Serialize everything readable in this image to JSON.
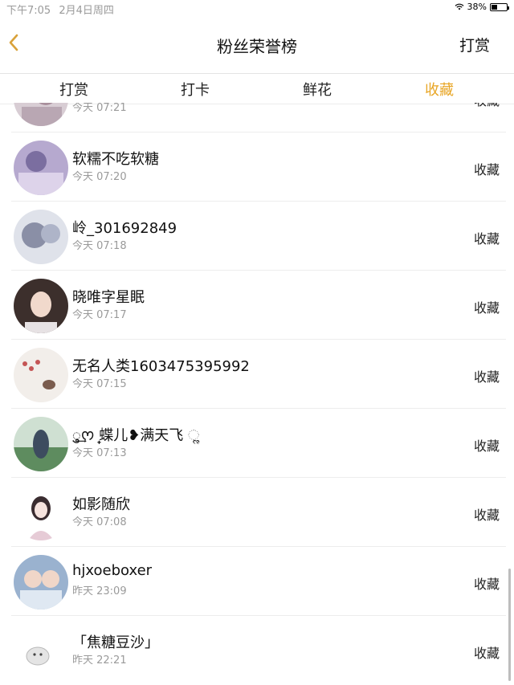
{
  "status_bar": {
    "time": "下午7:05",
    "date": "2月4日周四",
    "battery": "38%"
  },
  "nav": {
    "back_icon": "chevron-left-icon",
    "title": "粉丝荣誉榜",
    "action": "打赏"
  },
  "tabs": [
    {
      "label": "打赏",
      "active": false
    },
    {
      "label": "打卡",
      "active": false
    },
    {
      "label": "鲜花",
      "active": false
    },
    {
      "label": "收藏",
      "active": true
    }
  ],
  "accent_color": "#e8a524",
  "fans": [
    {
      "name": "",
      "time": "今天 07:21",
      "action": "收藏",
      "avatar_color": "#c9b7c2"
    },
    {
      "name": "软糯不吃软糖",
      "time": "今天 07:20",
      "action": "收藏",
      "avatar_color": "#a99bc4"
    },
    {
      "name": "岭_301692849",
      "time": "今天 07:18",
      "action": "收藏",
      "avatar_color": "#b9bfcf"
    },
    {
      "name": "晓唯字星眠",
      "time": "今天 07:17",
      "action": "收藏",
      "avatar_color": "#4b3a35"
    },
    {
      "name": "无名人类1603475395992",
      "time": "今天 07:15",
      "action": "收藏",
      "avatar_color": "#efe9e4"
    },
    {
      "name": "ु͢ᰔ᩠ 蝶儿❥满天飞 ૢ",
      "time": "今天 07:13",
      "action": "收藏",
      "avatar_color": "#5f8a66"
    },
    {
      "name": "如影随欣",
      "time": "今天 07:08",
      "action": "收藏",
      "avatar_color": "#f3e7ec"
    },
    {
      "name": "hjxoeboxer",
      "time": "昨天 23:09",
      "action": "收藏",
      "avatar_color": "#6f8fb5"
    },
    {
      "name": "「焦糖豆沙」",
      "time": "昨天 22:21",
      "action": "收藏",
      "avatar_color": "#f1f1f1"
    }
  ]
}
